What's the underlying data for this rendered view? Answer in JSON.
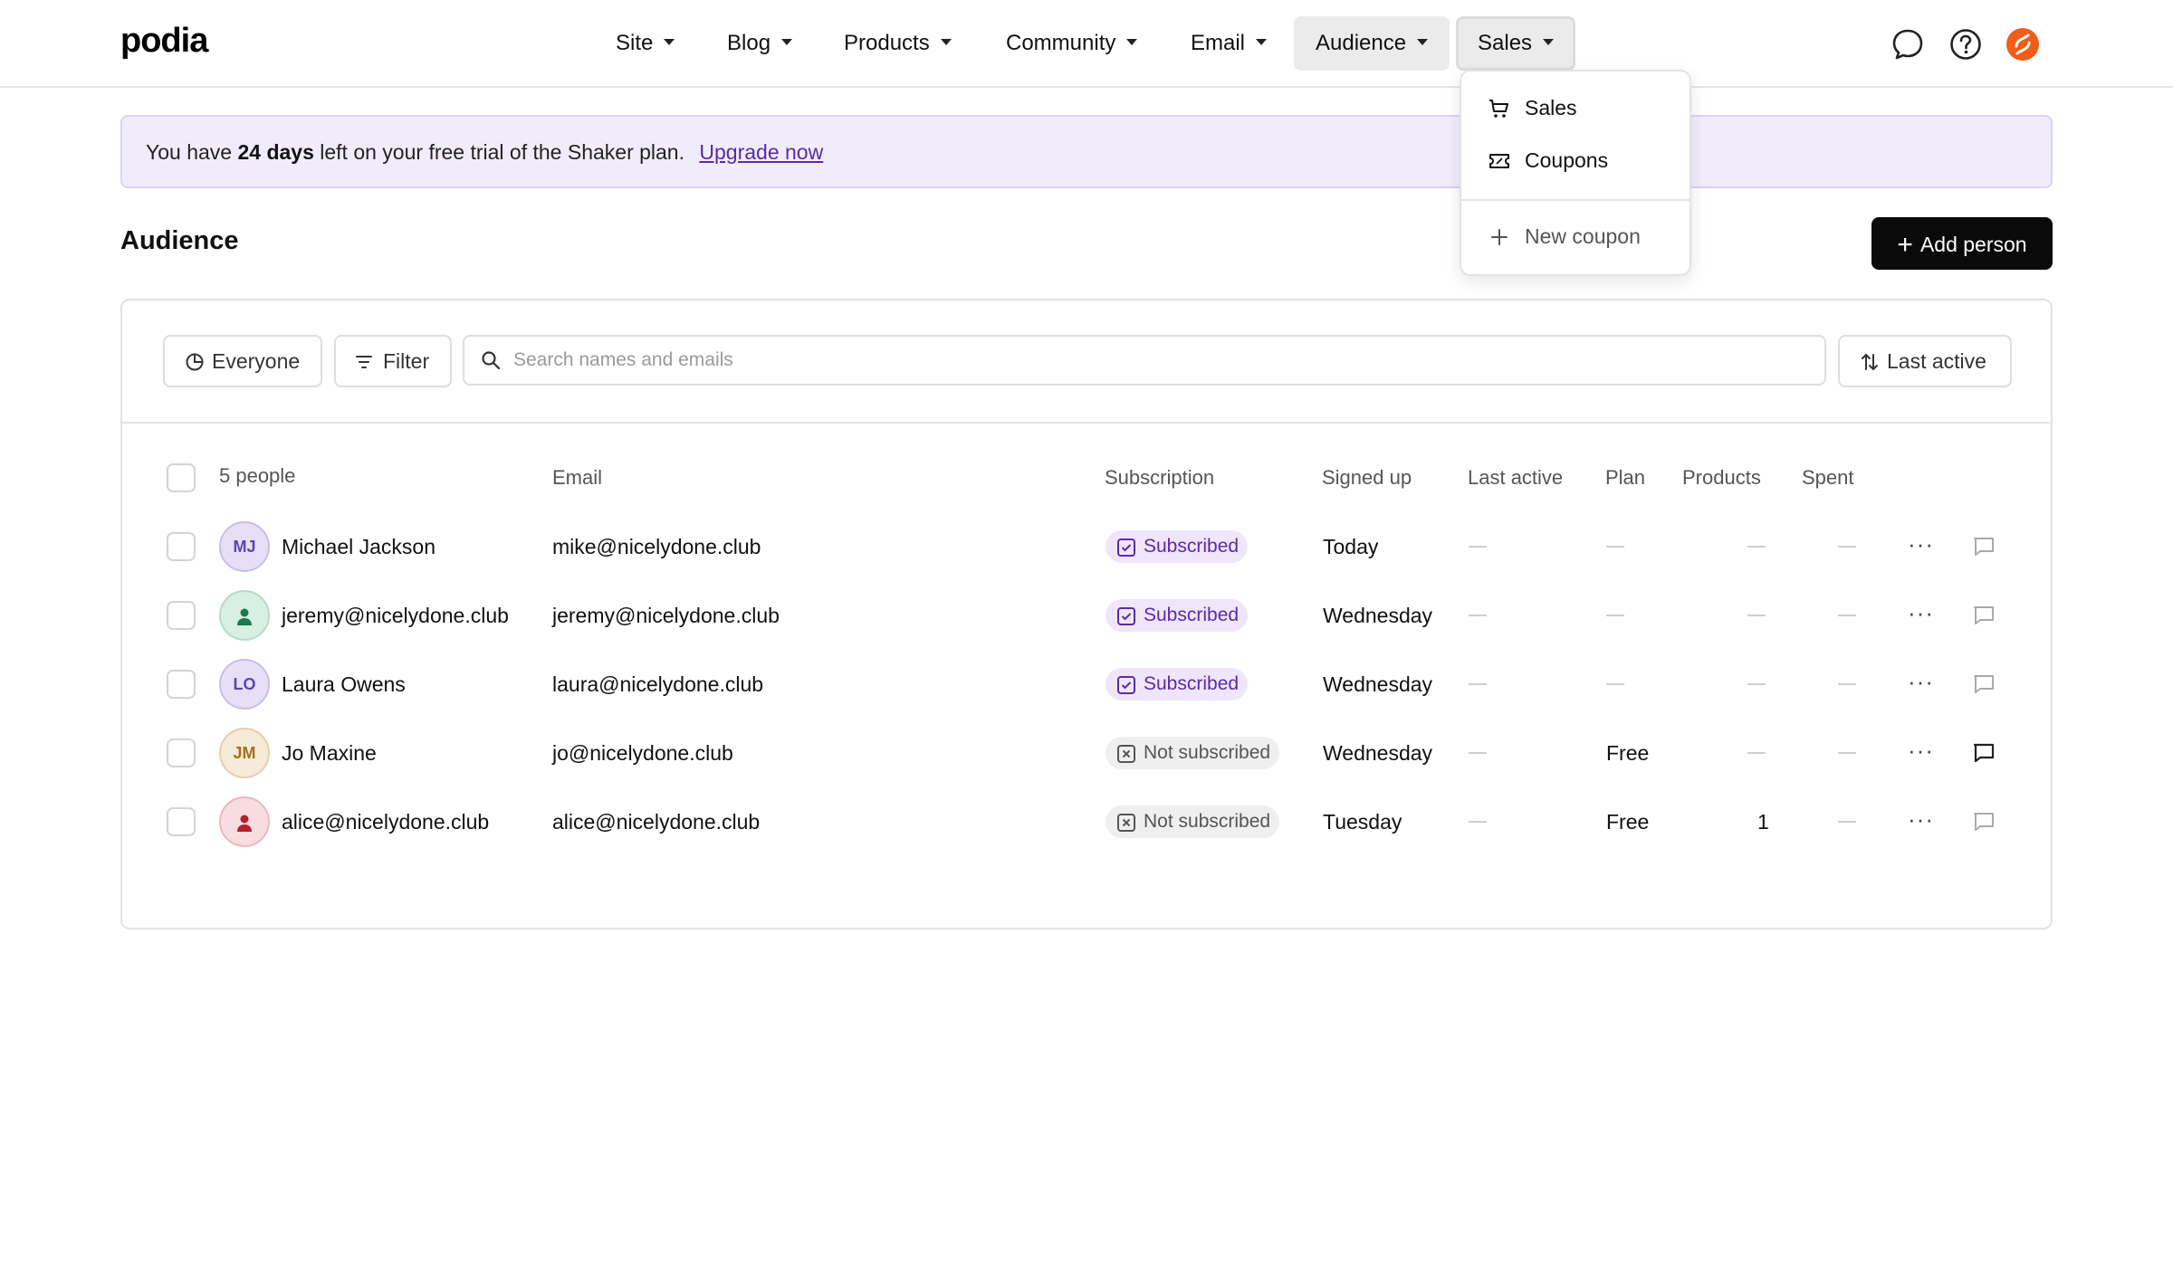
{
  "header": {
    "logo": "podia",
    "nav": [
      {
        "label": "Site"
      },
      {
        "label": "Blog"
      },
      {
        "label": "Products"
      },
      {
        "label": "Community"
      },
      {
        "label": "Email"
      },
      {
        "label": "Audience"
      },
      {
        "label": "Sales"
      }
    ],
    "icons": [
      "chat-icon",
      "help-icon",
      "profile-avatar-icon"
    ],
    "accent_color": "#f25c19"
  },
  "dropdown": {
    "items": [
      {
        "label": "Sales",
        "icon": "cart-icon"
      },
      {
        "label": "Coupons",
        "icon": "ticket-icon"
      },
      {
        "label": "New coupon",
        "icon": "plus-icon"
      }
    ]
  },
  "banner": {
    "prefix": "You have",
    "days": "24 days",
    "suffix": "left on your free trial of the Shaker plan.",
    "link": "Upgrade now"
  },
  "page": {
    "title": "Audience",
    "add_button": "Add person"
  },
  "toolbar": {
    "segment_label": "Everyone",
    "filter_label": "Filter",
    "search_placeholder": "Search names and emails",
    "sort_label": "Last active"
  },
  "table": {
    "count_label": "5 people",
    "columns": [
      "Email",
      "Subscription",
      "Signed up",
      "Last active",
      "Plan",
      "Products",
      "Spent"
    ],
    "rows": [
      {
        "initials": "MJ",
        "name": "Michael Jackson",
        "email": "mike@nicelydone.club",
        "subscription": "Subscribed",
        "signed_up": "Today",
        "plan": "",
        "products": ""
      },
      {
        "initials": "",
        "name": "jeremy@nicelydone.club",
        "email": "jeremy@nicelydone.club",
        "subscription": "Subscribed",
        "signed_up": "Wednesday",
        "plan": "",
        "products": ""
      },
      {
        "initials": "LO",
        "name": "Laura Owens",
        "email": "laura@nicelydone.club",
        "subscription": "Subscribed",
        "signed_up": "Wednesday",
        "plan": "",
        "products": ""
      },
      {
        "initials": "JM",
        "name": "Jo Maxine",
        "email": "jo@nicelydone.club",
        "subscription": "Not subscribed",
        "signed_up": "Wednesday",
        "plan": "Free",
        "products": ""
      },
      {
        "initials": "",
        "name": "alice@nicelydone.club",
        "email": "alice@nicelydone.club",
        "subscription": "Not subscribed",
        "signed_up": "Tuesday",
        "plan": "Free",
        "products": "1"
      }
    ],
    "more_glyph": "···"
  }
}
